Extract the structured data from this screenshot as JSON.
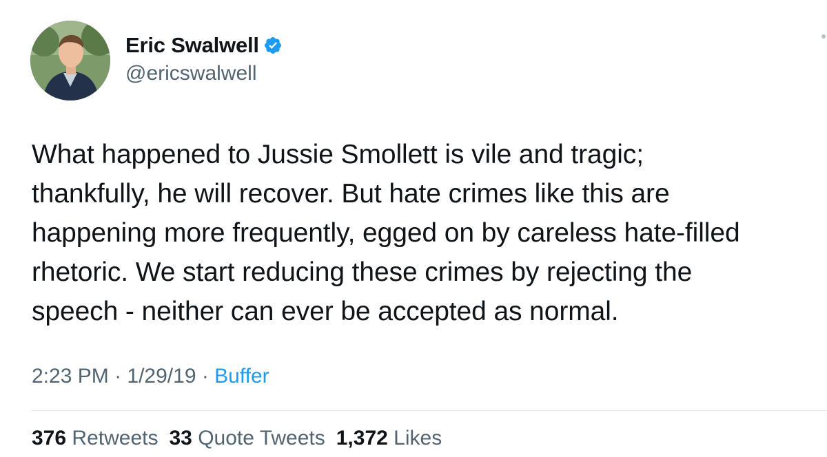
{
  "author": {
    "display_name": "Eric Swalwell",
    "handle": "@ericswalwell",
    "verified": true,
    "avatar_icon": "profile-photo",
    "verified_icon": "verified-badge-icon"
  },
  "colors": {
    "text": "#0f1419",
    "secondary": "#536471",
    "accent": "#1d9bf0"
  },
  "tweet": {
    "lines": [
      "What happened to Jussie Smollett is vile and tragic;",
      "thankfully, he will recover. But hate crimes like this are",
      "happening more frequently, egged on by careless hate-filled",
      "rhetoric. We start reducing these crimes by rejecting the",
      "speech - neither can ever be accepted as normal."
    ]
  },
  "meta": {
    "time": "2:23 PM",
    "sep1": " · ",
    "date": "1/29/19",
    "sep2": " · ",
    "source": "Buffer"
  },
  "stats": {
    "retweets_count": "376",
    "retweets_label": "Retweets",
    "quotes_count": "33",
    "quotes_label": "Quote Tweets",
    "likes_count": "1,372",
    "likes_label": "Likes"
  }
}
